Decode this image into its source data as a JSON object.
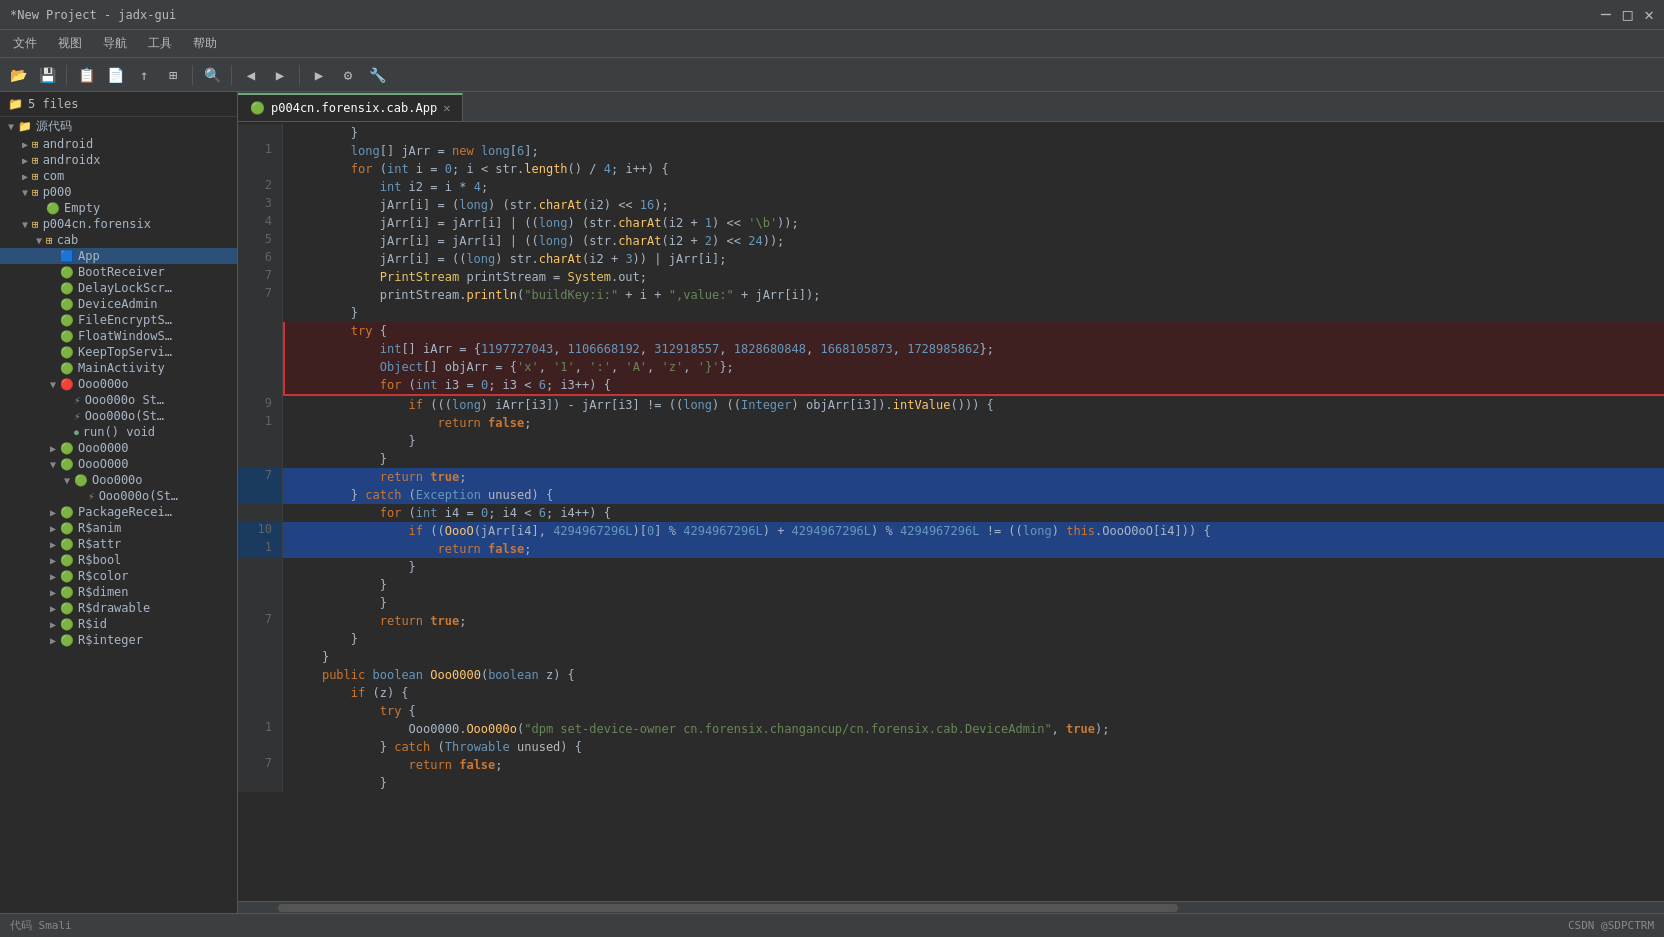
{
  "titlebar": {
    "title": "*New Project - jadx-gui",
    "controls": [
      "─",
      "□",
      "✕"
    ]
  },
  "menubar": {
    "items": [
      "文件",
      "视图",
      "导航",
      "工具",
      "帮助"
    ]
  },
  "sidebar": {
    "header": "5 files",
    "tree": [
      {
        "id": "root",
        "label": "源代码",
        "level": 0,
        "expanded": true,
        "icon": "folder"
      },
      {
        "id": "android",
        "label": "android",
        "level": 1,
        "expanded": false,
        "icon": "package"
      },
      {
        "id": "androidx",
        "label": "androidx",
        "level": 1,
        "expanded": false,
        "icon": "package"
      },
      {
        "id": "com",
        "label": "com",
        "level": 1,
        "expanded": false,
        "icon": "package"
      },
      {
        "id": "p000",
        "label": "p000",
        "level": 1,
        "expanded": true,
        "icon": "package"
      },
      {
        "id": "empty",
        "label": "Empty",
        "level": 2,
        "expanded": false,
        "icon": "class-g"
      },
      {
        "id": "p004cn",
        "label": "p004cn.forensix",
        "level": 1,
        "expanded": true,
        "icon": "package"
      },
      {
        "id": "cab",
        "label": "cab",
        "level": 2,
        "expanded": true,
        "icon": "package"
      },
      {
        "id": "App",
        "label": "App",
        "level": 3,
        "expanded": false,
        "icon": "class-b",
        "selected": true
      },
      {
        "id": "BootReceiver",
        "label": "BootReceiver",
        "level": 3,
        "expanded": false,
        "icon": "class-g"
      },
      {
        "id": "DelayLockScr",
        "label": "DelayLockScr…",
        "level": 3,
        "expanded": false,
        "icon": "class-g"
      },
      {
        "id": "DeviceAdmin",
        "label": "DeviceAdmin",
        "level": 3,
        "expanded": false,
        "icon": "class-g"
      },
      {
        "id": "FileEncryptS",
        "label": "FileEncryptS…",
        "level": 3,
        "expanded": false,
        "icon": "class-g"
      },
      {
        "id": "FloatWindows",
        "label": "FloatWindowS…",
        "level": 3,
        "expanded": false,
        "icon": "class-g"
      },
      {
        "id": "KeepTopServi",
        "label": "KeepTopServi…",
        "level": 3,
        "expanded": false,
        "icon": "class-g"
      },
      {
        "id": "MainActivity",
        "label": "MainActivity",
        "level": 3,
        "expanded": false,
        "icon": "class-g"
      },
      {
        "id": "Ooo0000",
        "label": "Ooo000o",
        "level": 3,
        "expanded": true,
        "icon": "class-r"
      },
      {
        "id": "Ooo0000St1",
        "label": "Ooo000o St…",
        "level": 4,
        "expanded": false,
        "icon": "method"
      },
      {
        "id": "Ooo0000o",
        "label": "Ooo000o(St…",
        "level": 4,
        "expanded": false,
        "icon": "method"
      },
      {
        "id": "run_void",
        "label": "run() void",
        "level": 4,
        "expanded": false,
        "icon": "method-circle"
      },
      {
        "id": "Ooo0000_2",
        "label": "Ooo0000",
        "level": 3,
        "expanded": false,
        "icon": "class-g"
      },
      {
        "id": "OooO000",
        "label": "OooO000",
        "level": 3,
        "expanded": true,
        "icon": "class-g"
      },
      {
        "id": "Ooo000o_sub",
        "label": "Ooo000o",
        "level": 4,
        "expanded": true,
        "icon": "class-g"
      },
      {
        "id": "Ooo000o_St",
        "label": "Ooo000o(St…",
        "level": 5,
        "expanded": false,
        "icon": "method"
      },
      {
        "id": "PackageRecei",
        "label": "PackageRecei…",
        "level": 3,
        "expanded": false,
        "icon": "class-g"
      },
      {
        "id": "R_anim",
        "label": "R$anim",
        "level": 3,
        "expanded": false,
        "icon": "class-g"
      },
      {
        "id": "R_attr",
        "label": "R$attr",
        "level": 3,
        "expanded": false,
        "icon": "class-g"
      },
      {
        "id": "R_bool",
        "label": "R$bool",
        "level": 3,
        "expanded": false,
        "icon": "class-g"
      },
      {
        "id": "R_color",
        "label": "R$color",
        "level": 3,
        "expanded": false,
        "icon": "class-g"
      },
      {
        "id": "R_dimen",
        "label": "R$dimen",
        "level": 3,
        "expanded": false,
        "icon": "class-g"
      },
      {
        "id": "R_drawable",
        "label": "R$drawable",
        "level": 3,
        "expanded": false,
        "icon": "class-g"
      },
      {
        "id": "R_id",
        "label": "R$id",
        "level": 3,
        "expanded": false,
        "icon": "class-g"
      },
      {
        "id": "R_integer",
        "label": "R$integer",
        "level": 3,
        "expanded": false,
        "icon": "class-g"
      }
    ]
  },
  "tabs": [
    {
      "id": "app-tab",
      "label": "p004cn.forensix.cab.App",
      "active": true,
      "icon": "🟢",
      "closable": true
    }
  ],
  "code": {
    "lines": [
      {
        "num": "",
        "content": "        }",
        "type": "normal"
      },
      {
        "num": "1",
        "content": "        long[] jArr = new long[6];",
        "type": "normal"
      },
      {
        "num": "",
        "content": "        for (int i = 0; i < str.length() / 4; i++) {",
        "type": "normal"
      },
      {
        "num": "2",
        "content": "            int i2 = i * 4;",
        "type": "normal"
      },
      {
        "num": "3",
        "content": "            jArr[i] = (long) (str.charAt(i2) << 16);",
        "type": "normal"
      },
      {
        "num": "4",
        "content": "            jArr[i] = jArr[i] | ((long) (str.charAt(i2 + 1) << '\\b'));",
        "type": "normal"
      },
      {
        "num": "5",
        "content": "            jArr[i] = jArr[i] | ((long) (str.charAt(i2 + 2) << 24));",
        "type": "normal"
      },
      {
        "num": "6",
        "content": "            jArr[i] = ((long) str.charAt(i2 + 3)) | jArr[i];",
        "type": "normal"
      },
      {
        "num": "7",
        "content": "            PrintStream printStream = System.out;",
        "type": "normal"
      },
      {
        "num": "7",
        "content": "            printStream.println(\"buildKey:i:\" + i + \",value:\" + jArr[i]);",
        "type": "normal"
      },
      {
        "num": "",
        "content": "        }",
        "type": "normal"
      },
      {
        "num": "",
        "content": "        try {",
        "type": "highlight-start"
      },
      {
        "num": "",
        "content": "            int[] iArr = {1197727043, 1106668192, 312918557, 1828680848, 1668105873, 1728985862};",
        "type": "highlight"
      },
      {
        "num": "",
        "content": "            Object[] objArr = {'x', '1', ':', 'A', 'z', '}'};",
        "type": "highlight"
      },
      {
        "num": "",
        "content": "            for (int i3 = 0; i3 < 6; i3++) {",
        "type": "highlight-end"
      },
      {
        "num": "9",
        "content": "                if (((long) iArr[i3]) - jArr[i3] != ((long) ((Integer) objArr[i3]).intValue())) {",
        "type": "normal"
      },
      {
        "num": "1",
        "content": "                    return false;",
        "type": "normal"
      },
      {
        "num": "",
        "content": "                }",
        "type": "normal"
      },
      {
        "num": "",
        "content": "            }",
        "type": "normal"
      },
      {
        "num": "7",
        "content": "            return true;",
        "type": "selected"
      },
      {
        "num": "",
        "content": "        } catch (Exception unused) {",
        "type": "selected"
      },
      {
        "num": "",
        "content": "            for (int i4 = 0; i4 < 6; i4++) {",
        "type": "normal"
      },
      {
        "num": "10",
        "content": "                if ((OooO(jArr[i4], 4294967296L)[0] % 4294967296L) + 4294967296L) % 4294967296L != ((long) this.OooO0oO[i4])) {",
        "type": "selected-line"
      },
      {
        "num": "1",
        "content": "                    return false;",
        "type": "selected"
      },
      {
        "num": "",
        "content": "                }",
        "type": "normal"
      },
      {
        "num": "",
        "content": "            }",
        "type": "normal"
      },
      {
        "num": "",
        "content": "            }",
        "type": "normal"
      },
      {
        "num": "7",
        "content": "            return true;",
        "type": "normal"
      },
      {
        "num": "",
        "content": "        }",
        "type": "normal"
      },
      {
        "num": "",
        "content": "    }",
        "type": "normal"
      },
      {
        "num": "",
        "content": "    public boolean Ooo0000(boolean z) {",
        "type": "normal"
      },
      {
        "num": "",
        "content": "        if (z) {",
        "type": "normal"
      },
      {
        "num": "",
        "content": "            try {",
        "type": "normal"
      },
      {
        "num": "1",
        "content": "                Ooo0000.Ooo000o(\"dpm set-device-owner cn.forensix.changancup/cn.forensix.cab.DeviceAdmin\", true);",
        "type": "normal"
      },
      {
        "num": "",
        "content": "            } catch (Throwable unused) {",
        "type": "normal"
      },
      {
        "num": "7",
        "content": "                return false;",
        "type": "normal"
      },
      {
        "num": "",
        "content": "            }",
        "type": "normal"
      }
    ]
  },
  "statusbar": {
    "left": "代码  Smali",
    "right": "CSDN @SDPCTRM"
  }
}
